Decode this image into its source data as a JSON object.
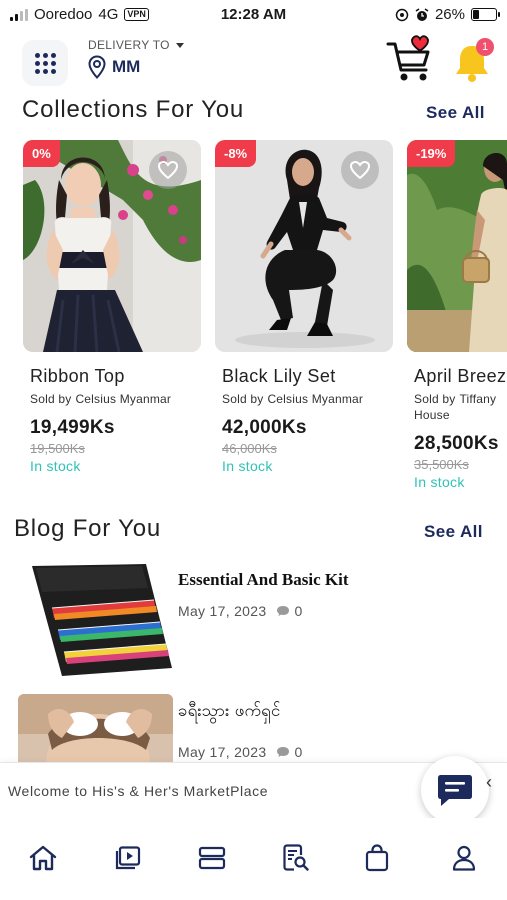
{
  "status_bar": {
    "carrier": "Ooredoo",
    "network": "4G",
    "vpn": "VPN",
    "time": "12:28 AM",
    "battery": "26%",
    "battery_level": 0.26
  },
  "header": {
    "delivery_label": "DELIVERY TO",
    "delivery_location": "MM",
    "notification_count": "1"
  },
  "collections": {
    "title": "Collections For You",
    "see_all": "See All",
    "items": [
      {
        "discount": "0%",
        "name": "Ribbon Top",
        "sold_by": "Sold by",
        "seller": "Celsius Myanmar",
        "price": "19,499Ks",
        "old_price": "19,500Ks",
        "stock": "In stock"
      },
      {
        "discount": "-8%",
        "name": "Black Lily Set",
        "sold_by": "Sold by",
        "seller": "Celsius Myanmar",
        "price": "42,000Ks",
        "old_price": "46,000Ks",
        "stock": "In stock"
      },
      {
        "discount": "-19%",
        "name": "April Breez",
        "sold_by": "Sold by",
        "seller": "Tiffany House",
        "price": "28,500Ks",
        "old_price": "35,500Ks",
        "stock": "In stock"
      }
    ]
  },
  "blog": {
    "title": "Blog For You",
    "see_all": "See All",
    "posts": [
      {
        "title": "Essential And Basic Kit",
        "date": "May 17, 2023",
        "comments": "0"
      },
      {
        "title": "ခရီးသွား ဖက်ရှင်",
        "date": "May 17, 2023",
        "comments": "0"
      }
    ]
  },
  "welcome": {
    "text": "Welcome to His's & Her's MarketPlace",
    "collapse_glyph": "‹"
  },
  "colors": {
    "brand_navy": "#1d2a5c",
    "discount_red": "#ef3b4a",
    "stock_teal": "#2ec4b6",
    "bell_yellow": "#f7c51e",
    "badge_pink": "#f0506e"
  },
  "bottom_nav": [
    {
      "icon": "home-icon"
    },
    {
      "icon": "video-icon"
    },
    {
      "icon": "collections-icon"
    },
    {
      "icon": "search-document-icon"
    },
    {
      "icon": "shopping-bag-icon"
    },
    {
      "icon": "profile-icon"
    }
  ]
}
